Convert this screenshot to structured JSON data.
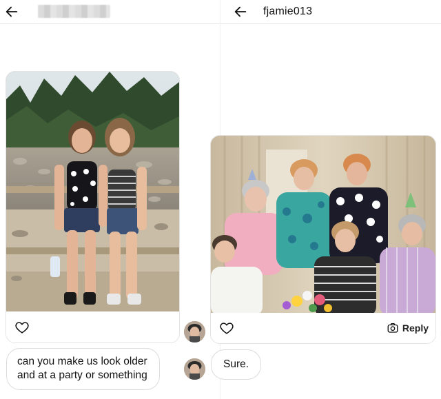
{
  "left_pane": {
    "header": {
      "title_redacted": true,
      "back_icon": "arrow-left-icon"
    },
    "post": {
      "photo_description_alt": "",
      "like_icon": "heart-icon"
    },
    "message": {
      "lines": [
        "can you make us look older",
        "and at a party or something"
      ]
    }
  },
  "right_pane": {
    "header": {
      "username": "fjamie013",
      "back_icon": "arrow-left-icon"
    },
    "post": {
      "like_icon": "heart-icon",
      "reply_label": "Reply",
      "reply_icon": "camera-icon"
    },
    "message": {
      "text": "Sure."
    }
  },
  "colors": {
    "border": "#e3e3e3",
    "text": "#111111",
    "background": "#ffffff"
  }
}
